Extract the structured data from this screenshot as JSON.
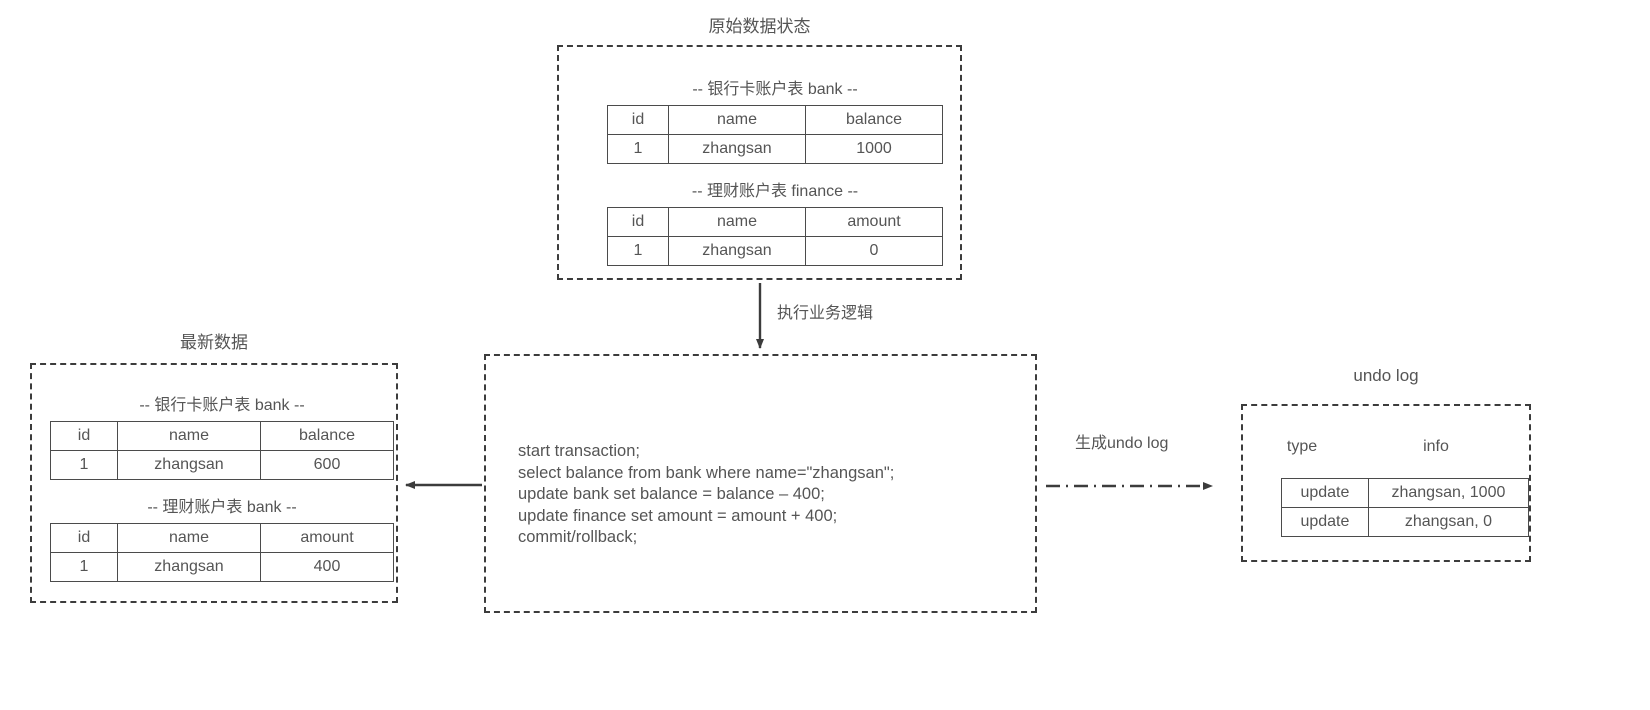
{
  "diagram": {
    "title_top": "原始数据状态",
    "title_left": "最新数据",
    "title_right": "undo log"
  },
  "original_state": {
    "caption": "原始数据状态",
    "tables": [
      {
        "title": "-- 银行卡账户表 bank --",
        "headers": [
          "id",
          "name",
          "balance"
        ],
        "rows": [
          [
            "1",
            "zhangsan",
            "1000"
          ]
        ]
      },
      {
        "title": "-- 理财账户表 finance --",
        "headers": [
          "id",
          "name",
          "amount"
        ],
        "rows": [
          [
            "1",
            "zhangsan",
            "0"
          ]
        ]
      }
    ]
  },
  "latest_data": {
    "caption": "最新数据",
    "tables": [
      {
        "title": "-- 银行卡账户表 bank --",
        "headers": [
          "id",
          "name",
          "balance"
        ],
        "rows": [
          [
            "1",
            "zhangsan",
            "600"
          ]
        ]
      },
      {
        "title": "-- 理财账户表 bank --",
        "headers": [
          "id",
          "name",
          "amount"
        ],
        "rows": [
          [
            "1",
            "zhangsan",
            "400"
          ]
        ]
      }
    ]
  },
  "transaction": {
    "sql_lines": [
      "start transaction;",
      "select balance from bank where name=\"zhangsan\";",
      "update bank set balance = balance – 400;",
      "update finance set amount = amount + 400;",
      "commit/rollback;"
    ]
  },
  "undo_log": {
    "caption": "undo log",
    "headers": [
      "type",
      "info"
    ],
    "rows": [
      [
        "update",
        "zhangsan,  1000"
      ],
      [
        "update",
        "zhangsan,  0"
      ]
    ]
  },
  "connectors": {
    "exec_label": "执行业务逻辑",
    "undo_label": "生成undo log"
  },
  "colors": {
    "stroke": "#3c3c3c",
    "text": "#555555",
    "table_border": "#4b4b4b",
    "background": "#ffffff"
  }
}
